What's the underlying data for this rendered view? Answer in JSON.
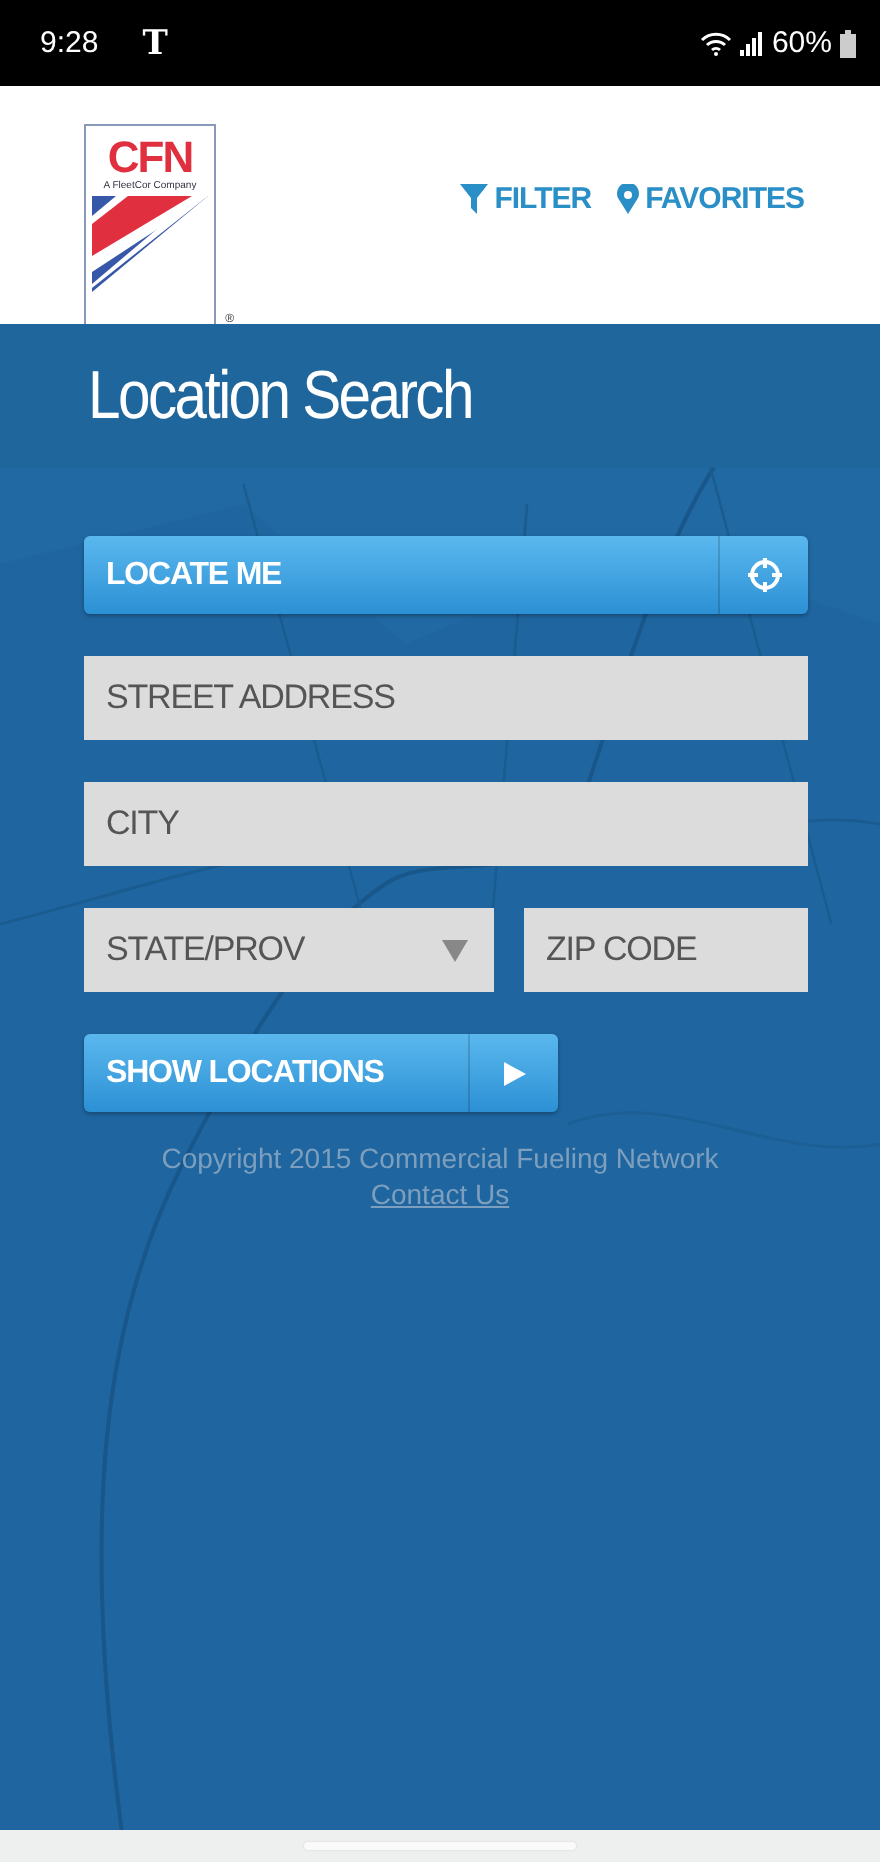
{
  "status_bar": {
    "time": "9:28",
    "carrier": "T",
    "battery": "60%"
  },
  "header": {
    "logo": {
      "name": "CFN",
      "tagline": "A FleetCor Company",
      "mark": "®"
    },
    "nav": [
      {
        "kind": "filter",
        "label": "FILTER"
      },
      {
        "kind": "pin",
        "label": "FAVORITES"
      }
    ]
  },
  "title": "Location Search",
  "locate_button": {
    "label": "LOCATE ME"
  },
  "fields": [
    {
      "placeholder": "STREET ADDRESS"
    },
    {
      "placeholder": "CITY"
    }
  ],
  "state_select": {
    "placeholder": "STATE/PROV"
  },
  "zip_field": {
    "placeholder": "ZIP CODE"
  },
  "show_button": {
    "label": "SHOW LOCATIONS"
  },
  "footer": {
    "copyright": "Copyright 2015 Commercial Fueling Network",
    "link": "Contact Us"
  }
}
